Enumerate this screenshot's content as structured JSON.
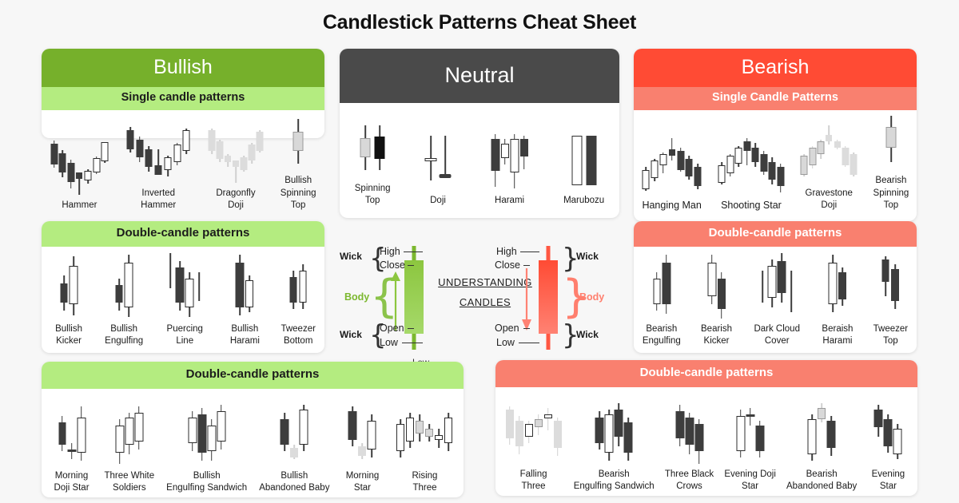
{
  "title": "Candlestick Patterns Cheat Sheet",
  "colors": {
    "background": "#f7f7f7",
    "bullish_header": "#76b02b",
    "bullish_sub": "#b4ec80",
    "neutral_header": "#4a4a4a",
    "bearish_header": "#ff4b34",
    "bearish_sub": "#f9806f",
    "candle_dark": "#3d3d3d",
    "candle_light": "#dcdcdc",
    "green_candle": "#7cb82f",
    "red_candle": "#ff5742"
  },
  "bullish": {
    "header": "Bullish",
    "single": {
      "subheader": "Single candle patterns",
      "patterns": [
        {
          "label": "Hammer"
        },
        {
          "label": "Inverted\nHammer"
        },
        {
          "label": "Dragonfly\nDoji"
        },
        {
          "label": "Bullish\nSpinning\nTop"
        }
      ]
    },
    "double": {
      "subheader": "Double-candle patterns",
      "patterns": [
        {
          "label": "Bullish\nKicker"
        },
        {
          "label": "Bullish\nEngulfing"
        },
        {
          "label": "Puercing\nLine"
        },
        {
          "label": "Bullish\nHarami"
        },
        {
          "label": "Tweezer\nBottom"
        }
      ]
    }
  },
  "neutral": {
    "header": "Neutral",
    "patterns": [
      {
        "label": "Spinning\nTop"
      },
      {
        "label": "Doji"
      },
      {
        "label": "Harami"
      },
      {
        "label": "Marubozu"
      }
    ]
  },
  "bearish": {
    "header": "Bearish",
    "single": {
      "subheader": "Single Candle Patterns",
      "patterns": [
        {
          "label": "Hanging Man"
        },
        {
          "label": "Shooting Star"
        },
        {
          "label": "Gravestone\nDoji"
        },
        {
          "label": "Bearish\nSpinning\nTop"
        }
      ]
    },
    "double": {
      "subheader": "Double-candle patterns",
      "patterns": [
        {
          "label": "Bearish\nEngulfing"
        },
        {
          "label": "Bearish\nKicker"
        },
        {
          "label": "Dark Cloud\nCover"
        },
        {
          "label": "Beraish\nHarami"
        },
        {
          "label": "Tweezer\nTop"
        }
      ]
    }
  },
  "understanding": {
    "title_line1": "UNDERSTANDING",
    "title_line2": "CANDLES",
    "green": {
      "wick_top": "Wick",
      "wick_bottom": "Wick",
      "body": "Body",
      "high": "High",
      "close": "Close",
      "open": "Open",
      "low": "Low"
    },
    "red": {
      "wick_top": "Wick",
      "wick_bottom": "Wick",
      "body": "Body",
      "high": "High",
      "close": "Close",
      "open": "Open",
      "low": "Low"
    },
    "stray_low": "Low"
  },
  "bullish_multi": {
    "subheader": "Double-candle patterns",
    "patterns": [
      {
        "label": "Morning\nDoji Star"
      },
      {
        "label": "Three White\nSoldiers"
      },
      {
        "label": "Bullish\nEngulfing Sandwich"
      },
      {
        "label": "Bullish\nAbandoned Baby"
      },
      {
        "label": "Morning\nStar"
      },
      {
        "label": "Rising\nThree"
      }
    ]
  },
  "bearish_multi": {
    "subheader": "Double-candle patterns",
    "patterns": [
      {
        "label": "Falling\nThree"
      },
      {
        "label": "Bearish\nEngulfing Sandwich"
      },
      {
        "label": "Three Black\nCrows"
      },
      {
        "label": "Evening Doji\nStar"
      },
      {
        "label": "Bearish\nAbandoned Baby"
      },
      {
        "label": "Evening\nStar"
      }
    ]
  }
}
